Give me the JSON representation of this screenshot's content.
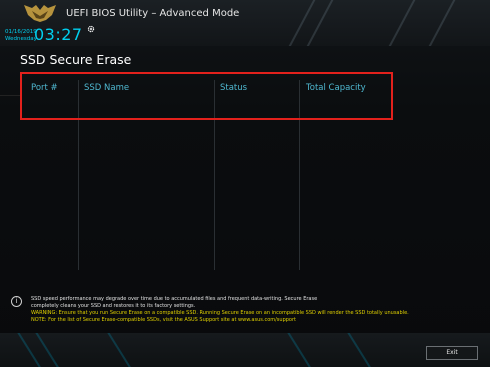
{
  "header": {
    "title": "UEFI BIOS Utility – Advanced Mode",
    "date": "01/16/2019",
    "weekday": "Wednesday",
    "time": "03:27"
  },
  "page": {
    "title": "SSD Secure Erase"
  },
  "table": {
    "columns": [
      "Port #",
      "SSD Name",
      "Status",
      "Total Capacity"
    ],
    "rows": []
  },
  "info": {
    "line1": "SSD speed performance may degrade over time due to accumulated files and frequent data-writing. Secure Erase",
    "line2": "completely cleans your SSD and restores it to its factory settings.",
    "warning": "WARNING: Ensure that you run Secure Erase on a compatible SSD. Running Secure Erase on an incompatible SSD will render the SSD totally unusable.",
    "note": "NOTE: For the list of Secure Erase-compatible SSDs, visit the ASUS Support site at www.asus.com/support"
  },
  "footer": {
    "exit_label": "Exit"
  },
  "colors": {
    "accent_cyan": "#00d0f0",
    "header_text": "#4fb8d0",
    "warning_yellow": "#e0d000",
    "highlight_red": "#e3211c"
  }
}
